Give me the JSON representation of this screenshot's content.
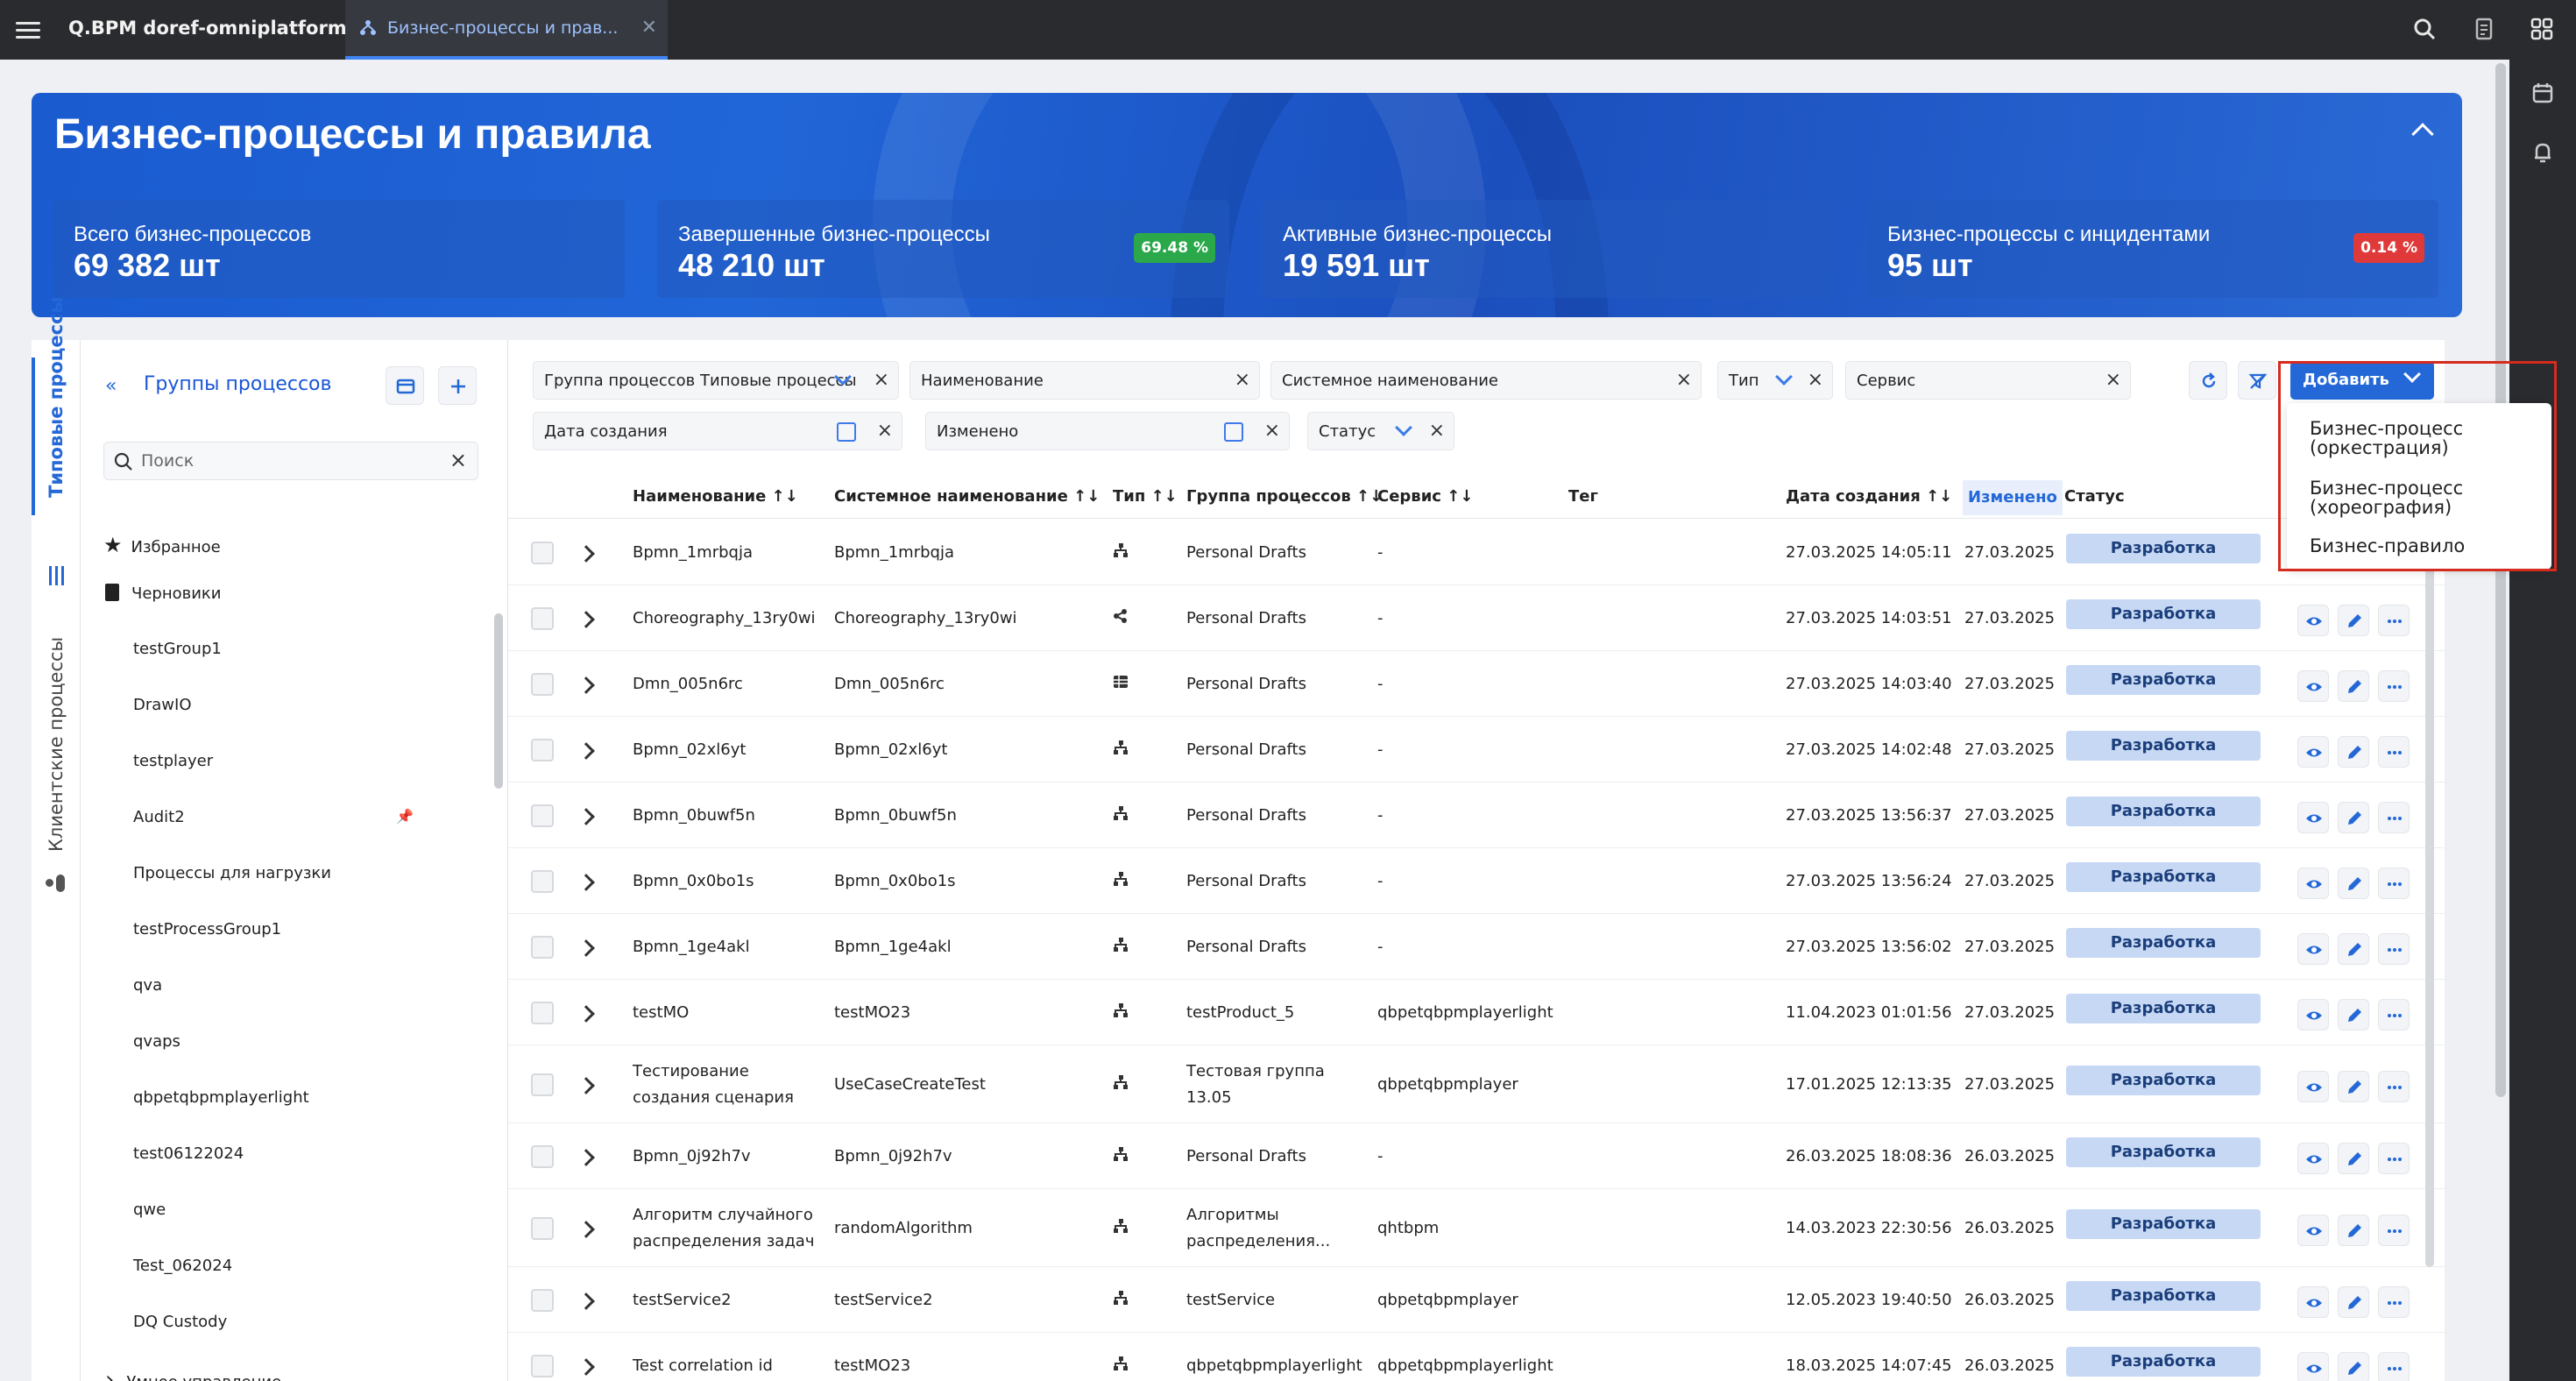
{
  "app": {
    "title": "Q.BPM doref-omniplatform"
  },
  "tab": {
    "label": "Бизнес-процессы и прав...",
    "close": "✕"
  },
  "hero": {
    "title": "Бизнес-процессы и правила",
    "kpis": [
      {
        "title": "Всего бизнес-процессов",
        "value": "69 382 шт",
        "badge": ""
      },
      {
        "title": "Завершенные бизнес-процессы",
        "value": "48 210 шт",
        "badge": "69.48 %"
      },
      {
        "title": "Активные бизнес-процессы",
        "value": "19 591 шт",
        "badge": ""
      },
      {
        "title": "Бизнес-процессы с инцидентами",
        "value": "95 шт",
        "badge": "0.14 %"
      }
    ],
    "badge_colors": {
      "success": "#2aa84a",
      "danger": "#e0393a"
    }
  },
  "side_tabs": {
    "typical": "Типовые процессы",
    "client": "Клиентские процессы"
  },
  "groups": {
    "header": "Группы процессов",
    "search_placeholder": "Поиск",
    "items": [
      {
        "label": "Избранное",
        "icon": "star-icon"
      },
      {
        "label": "Черновики",
        "icon": "file-icon"
      },
      {
        "label": "testGroup1"
      },
      {
        "label": "DrawIO"
      },
      {
        "label": "testplayer"
      },
      {
        "label": "Audit2",
        "pinned": true
      },
      {
        "label": "Процессы для нагрузки"
      },
      {
        "label": "testProcessGroup1"
      },
      {
        "label": "qva"
      },
      {
        "label": "qvaps"
      },
      {
        "label": "qbpetqbpmplayerlight"
      },
      {
        "label": "test06122024"
      },
      {
        "label": "qwe"
      },
      {
        "label": "Test_062024"
      },
      {
        "label": "DQ Custody"
      },
      {
        "label": "Умное управление",
        "expandable": true
      }
    ]
  },
  "filters": {
    "group": "Группа процессов Типовые процессы",
    "name": "Наименование",
    "system_name": "Системное наименование",
    "type": "Тип",
    "service": "Сервис",
    "created": "Дата создания",
    "changed": "Изменено",
    "status": "Статус",
    "add_button": "Добавить"
  },
  "add_menu": [
    "Бизнес-процесс\n(оркестрация)",
    "Бизнес-процесс\n(хореография)",
    "Бизнес-правило"
  ],
  "add_menu_lines": [
    [
      "Бизнес-процесс",
      "(оркестрация)"
    ],
    [
      "Бизнес-процесс",
      "(хореография)"
    ],
    [
      "Бизнес-правило"
    ]
  ],
  "columns": {
    "name": "Наименование",
    "system_name": "Системное наименование",
    "type": "Тип",
    "group": "Группа процессов",
    "service": "Сервис",
    "tag": "Тег",
    "created": "Дата создания",
    "changed": "Изменено",
    "status": "Статус"
  },
  "rows": [
    {
      "name": [
        "Bpmn_1mrbqja"
      ],
      "system": "Bpmn_1mrbqja",
      "type": "bpmn",
      "group": [
        "Personal Drafts"
      ],
      "service": "-",
      "created": "27.03.2025 14:05:11",
      "changed": "27.03.2025",
      "status": "Разработка"
    },
    {
      "name": [
        "Choreography_13ry0wi"
      ],
      "system": "Choreography_13ry0wi",
      "type": "choreo",
      "group": [
        "Personal Drafts"
      ],
      "service": "-",
      "created": "27.03.2025 14:03:51",
      "changed": "27.03.2025",
      "status": "Разработка"
    },
    {
      "name": [
        "Dmn_005n6rc"
      ],
      "system": "Dmn_005n6rc",
      "type": "dmn",
      "group": [
        "Personal Drafts"
      ],
      "service": "-",
      "created": "27.03.2025 14:03:40",
      "changed": "27.03.2025",
      "status": "Разработка"
    },
    {
      "name": [
        "Bpmn_02xl6yt"
      ],
      "system": "Bpmn_02xl6yt",
      "type": "bpmn",
      "group": [
        "Personal Drafts"
      ],
      "service": "-",
      "created": "27.03.2025 14:02:48",
      "changed": "27.03.2025",
      "status": "Разработка"
    },
    {
      "name": [
        "Bpmn_0buwf5n"
      ],
      "system": "Bpmn_0buwf5n",
      "type": "bpmn",
      "group": [
        "Personal Drafts"
      ],
      "service": "-",
      "created": "27.03.2025 13:56:37",
      "changed": "27.03.2025",
      "status": "Разработка"
    },
    {
      "name": [
        "Bpmn_0x0bo1s"
      ],
      "system": "Bpmn_0x0bo1s",
      "type": "bpmn",
      "group": [
        "Personal Drafts"
      ],
      "service": "-",
      "created": "27.03.2025 13:56:24",
      "changed": "27.03.2025",
      "status": "Разработка"
    },
    {
      "name": [
        "Bpmn_1ge4akl"
      ],
      "system": "Bpmn_1ge4akl",
      "type": "bpmn",
      "group": [
        "Personal Drafts"
      ],
      "service": "-",
      "created": "27.03.2025 13:56:02",
      "changed": "27.03.2025",
      "status": "Разработка"
    },
    {
      "name": [
        "testMO"
      ],
      "system": "testMO23",
      "type": "bpmn",
      "group": [
        "testProduct_5"
      ],
      "service": "qbpetqbpmplayerlight",
      "created": "11.04.2023 01:01:56",
      "changed": "27.03.2025",
      "status": "Разработка"
    },
    {
      "name": [
        "Тестирование",
        "создания сценария"
      ],
      "system": "UseCaseCreateTest",
      "type": "bpmn",
      "group": [
        "Тестовая группа",
        "13.05"
      ],
      "service": "qbpetqbpmplayer",
      "created": "17.01.2025 12:13:35",
      "changed": "27.03.2025",
      "status": "Разработка"
    },
    {
      "name": [
        "Bpmn_0j92h7v"
      ],
      "system": "Bpmn_0j92h7v",
      "type": "bpmn",
      "group": [
        "Personal Drafts"
      ],
      "service": "-",
      "created": "26.03.2025 18:08:36",
      "changed": "26.03.2025",
      "status": "Разработка"
    },
    {
      "name": [
        "Алгоритм случайного",
        "распределения задач"
      ],
      "system": "randomAlgorithm",
      "type": "bpmn",
      "group": [
        "Алгоритмы",
        "распределения..."
      ],
      "service": "qhtbpm",
      "created": "14.03.2023 22:30:56",
      "changed": "26.03.2025",
      "status": "Разработка"
    },
    {
      "name": [
        "testService2"
      ],
      "system": "testService2",
      "type": "bpmn",
      "group": [
        "testService"
      ],
      "service": "qbpetqbpmplayer",
      "created": "12.05.2023 19:40:50",
      "changed": "26.03.2025",
      "status": "Разработка"
    },
    {
      "name": [
        "Test correlation id"
      ],
      "system": "testMO23",
      "type": "bpmn",
      "group": [
        "qbpetqbpmplayerlight"
      ],
      "service": "qbpetqbpmplayerlight",
      "created": "18.03.2025 14:07:45",
      "changed": "26.03.2025",
      "status": "Разработка"
    }
  ]
}
